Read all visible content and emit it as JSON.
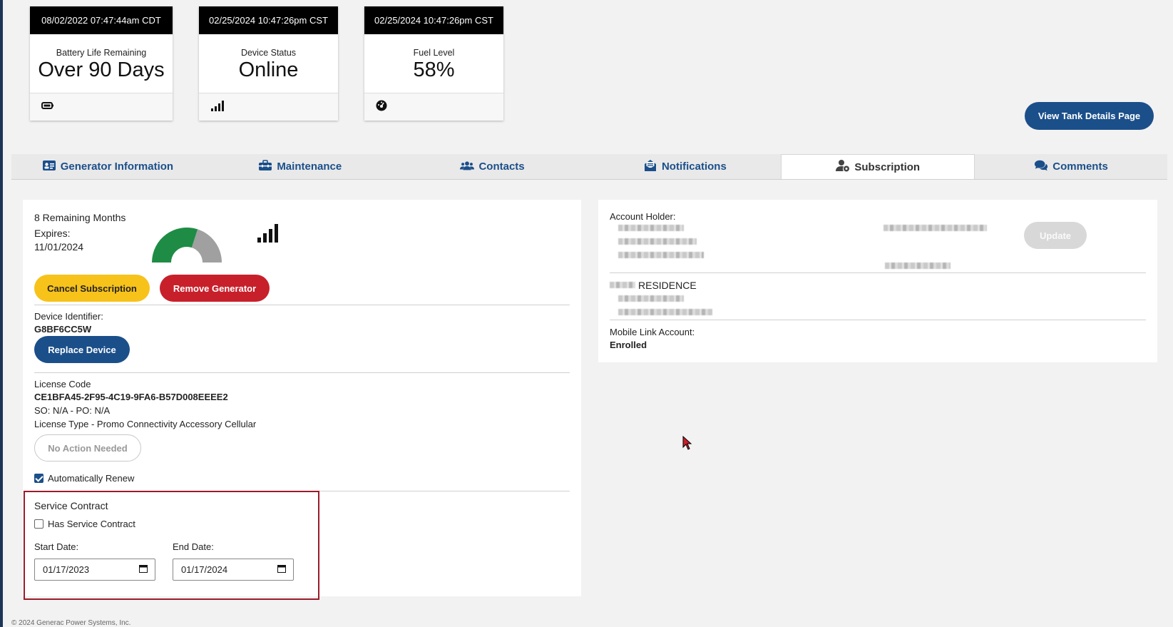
{
  "cards": [
    {
      "timestamp": "08/02/2022 07:47:44am CDT",
      "label": "Battery Life Remaining",
      "value": "Over 90 Days",
      "icon": "battery-icon"
    },
    {
      "timestamp": "02/25/2024 10:47:26pm CST",
      "label": "Device Status",
      "value": "Online",
      "icon": "signal-bars-icon"
    },
    {
      "timestamp": "02/25/2024 10:47:26pm CST",
      "label": "Fuel Level",
      "value": "58%",
      "icon": "gauge-icon"
    }
  ],
  "tank_button": "View Tank Details Page",
  "tabs": [
    {
      "label": "Generator Information",
      "icon": "id-card-icon"
    },
    {
      "label": "Maintenance",
      "icon": "toolbox-icon"
    },
    {
      "label": "Contacts",
      "icon": "users-icon"
    },
    {
      "label": "Notifications",
      "icon": "envelope-icon"
    },
    {
      "label": "Subscription",
      "icon": "user-gear-icon",
      "active": true
    },
    {
      "label": "Comments",
      "icon": "chat-icon"
    }
  ],
  "subscription": {
    "remaining": "8 Remaining Months",
    "expires_label": "Expires:",
    "expires_date": "11/01/2024",
    "remaining_fraction": 0.6,
    "cancel_button": "Cancel Subscription",
    "remove_button": "Remove Generator",
    "device_identifier_label": "Device Identifier:",
    "device_identifier": "G8BF6CC5W",
    "replace_button": "Replace Device",
    "license_code_label": "License Code",
    "license_code": "CE1BFA45-2F95-4C19-9FA6-B57D008EEEE2",
    "so_po": "SO: N/A - PO: N/A",
    "license_type": "License Type - Promo Connectivity Accessory Cellular",
    "no_action_button": "No Action Needed",
    "auto_renew_label": "Automatically Renew",
    "auto_renew": true
  },
  "service_contract": {
    "title": "Service Contract",
    "has_contract_label": "Has Service Contract",
    "has_contract": false,
    "start_label": "Start Date:",
    "start_value": "01/17/2023",
    "end_label": "End Date:",
    "end_value": "01/17/2024"
  },
  "account": {
    "holder_label": "Account Holder:",
    "update_button": "Update",
    "residence": "RESIDENCE",
    "mobile_link_label": "Mobile Link Account:",
    "mobile_link_value": "Enrolled"
  },
  "footer": "© 2024 Generac Power Systems, Inc.",
  "colors": {
    "accent": "#1b4f8a",
    "warning": "#f7c21a",
    "danger": "#c8202b",
    "gauge_fill": "#1e8c45",
    "gauge_rest": "#a0a0a0"
  }
}
